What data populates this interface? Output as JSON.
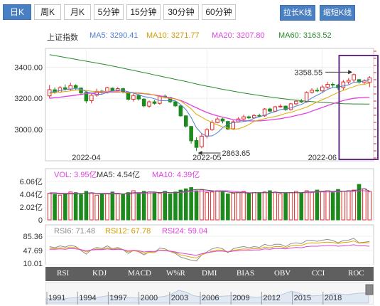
{
  "tabs": {
    "daily": "日K",
    "weekly": "周K",
    "monthly": "月K",
    "min5": "5分钟",
    "min15": "15分钟",
    "min30": "30分钟",
    "min60": "60分钟"
  },
  "buttons": {
    "stretch": "拉长K线",
    "shrink": "缩短K线"
  },
  "legend": {
    "name": "上证指数",
    "ma5": "MA5: 3290.41",
    "ma10": "MA10: 3271.77",
    "ma20": "MA20: 3207.80",
    "ma60": "MA60: 3163.52"
  },
  "volume_legend": {
    "vol": "VOL: 3.95亿",
    "ma5": "MA5: 4.54亿",
    "ma10": "MA10: 4.39亿"
  },
  "rsi_legend": {
    "rsi6": "RSI6: 71.48",
    "rsi12": "RSI12: 67.78",
    "rsi24": "RSI24: 59.04"
  },
  "indicator_tabs": [
    "RSI",
    "KDJ",
    "MACD",
    "W%R",
    "DMI",
    "BIAS",
    "OBV",
    "CCI",
    "ROC"
  ],
  "timeline_years": [
    "1991",
    "1994",
    "1997",
    "2000",
    "2003",
    "2006",
    "2009",
    "2012",
    "2015",
    "2018"
  ],
  "colors": {
    "up": "#e2292b",
    "down": "#1d8a1d",
    "ma5": "#4f7fd1",
    "ma10": "#e0a800",
    "ma20": "#e040e0",
    "ma60": "#2a8a2a",
    "rsi6": "#8e8e8e",
    "rsi12": "#e0a800",
    "rsi24": "#e040e0",
    "highlight_box": "#6b2d8a",
    "tab_active": "#4a7fc1"
  },
  "chart_data": [
    {
      "type": "candlestick",
      "ylim": [
        2800,
        3520
      ],
      "yticks": [
        3400,
        3200,
        3000
      ],
      "yticklabels": [
        "3400.00",
        "3200.00",
        "3000.00"
      ],
      "xticklabels": [
        "2022-04",
        "2022-05",
        "2022-06"
      ],
      "annotations": [
        {
          "text": "3358.55",
          "x": 58,
          "y": 3358.55
        },
        {
          "text": "2863.65",
          "x": 28,
          "y": 2863.65
        }
      ],
      "candles": [
        [
          3216,
          3256,
          3285,
          3200
        ],
        [
          3255,
          3240,
          3270,
          3230
        ],
        [
          3240,
          3268,
          3278,
          3235
        ],
        [
          3268,
          3260,
          3289,
          3250
        ],
        [
          3259,
          3282,
          3300,
          3248
        ],
        [
          3282,
          3268,
          3290,
          3255
        ],
        [
          3266,
          3235,
          3270,
          3220
        ],
        [
          3238,
          3184,
          3241,
          3170
        ],
        [
          3185,
          3220,
          3230,
          3168
        ],
        [
          3220,
          3245,
          3262,
          3210
        ],
        [
          3246,
          3238,
          3255,
          3228
        ],
        [
          3238,
          3268,
          3275,
          3231
        ],
        [
          3265,
          3248,
          3270,
          3238
        ],
        [
          3248,
          3262,
          3272,
          3240
        ],
        [
          3262,
          3242,
          3268,
          3232
        ],
        [
          3240,
          3194,
          3245,
          3186
        ],
        [
          3194,
          3218,
          3229,
          3180
        ],
        [
          3218,
          3196,
          3225,
          3186
        ],
        [
          3195,
          3152,
          3201,
          3143
        ],
        [
          3150,
          3178,
          3186,
          3140
        ],
        [
          3178,
          3168,
          3189,
          3160
        ],
        [
          3168,
          3212,
          3220,
          3160
        ],
        [
          3214,
          3208,
          3225,
          3200
        ],
        [
          3205,
          3178,
          3210,
          3170
        ],
        [
          3178,
          3152,
          3183,
          3145
        ],
        [
          3152,
          3088,
          3155,
          3083
        ],
        [
          3088,
          3022,
          3092,
          3012
        ],
        [
          3020,
          2928,
          3022,
          2910
        ],
        [
          2930,
          2886,
          2950,
          2863
        ],
        [
          2890,
          2958,
          2975,
          2880
        ],
        [
          2958,
          3000,
          3010,
          2944
        ],
        [
          3000,
          3045,
          3060,
          2992
        ],
        [
          3045,
          3068,
          3081,
          3040
        ],
        [
          3068,
          3055,
          3075,
          3040
        ],
        [
          3052,
          3004,
          3056,
          2998
        ],
        [
          3005,
          3050,
          3060,
          2998
        ],
        [
          3050,
          3068,
          3080,
          3045
        ],
        [
          3068,
          3082,
          3095,
          3060
        ],
        [
          3082,
          3075,
          3090,
          3066
        ],
        [
          3075,
          3090,
          3100,
          3068
        ],
        [
          3090,
          3088,
          3102,
          3080
        ],
        [
          3088,
          3132,
          3138,
          3082
        ],
        [
          3132,
          3118,
          3140,
          3110
        ],
        [
          3118,
          3146,
          3152,
          3112
        ],
        [
          3146,
          3150,
          3162,
          3140
        ],
        [
          3150,
          3128,
          3155,
          3120
        ],
        [
          3128,
          3165,
          3170,
          3122
        ],
        [
          3165,
          3182,
          3190,
          3158
        ],
        [
          3182,
          3178,
          3196,
          3170
        ],
        [
          3178,
          3238,
          3245,
          3172
        ],
        [
          3238,
          3252,
          3265,
          3230
        ],
        [
          3252,
          3248,
          3268,
          3240
        ],
        [
          3248,
          3273,
          3285,
          3238
        ],
        [
          3272,
          3290,
          3305,
          3262
        ],
        [
          3290,
          3285,
          3302,
          3270
        ],
        [
          3284,
          3268,
          3292,
          3254
        ],
        [
          3268,
          3305,
          3318,
          3255
        ],
        [
          3305,
          3315,
          3330,
          3290
        ],
        [
          3318,
          3352,
          3359,
          3300
        ],
        [
          3320,
          3304,
          3325,
          3294
        ],
        [
          3302,
          3312,
          3323,
          3288
        ],
        [
          3302,
          3332,
          3342,
          3272
        ]
      ],
      "ma5": [
        3238,
        3244,
        3250,
        3256,
        3260,
        3262,
        3259,
        3244,
        3233,
        3226,
        3226,
        3239,
        3248,
        3252,
        3251,
        3242,
        3233,
        3224,
        3211,
        3207,
        3198,
        3186,
        3185,
        3187,
        3184,
        3160,
        3128,
        3078,
        3012,
        2975,
        2958,
        2960,
        2980,
        3012,
        3035,
        3045,
        3048,
        3052,
        3056,
        3073,
        3081,
        3093,
        3105,
        3115,
        3128,
        3134,
        3138,
        3151,
        3161,
        3178,
        3203,
        3220,
        3237,
        3258,
        3270,
        3274,
        3279,
        3286,
        3303,
        3305,
        3312,
        3322
      ],
      "ma10": [
        3232,
        3236,
        3240,
        3244,
        3248,
        3252,
        3254,
        3250,
        3246,
        3243,
        3243,
        3246,
        3246,
        3243,
        3239,
        3234,
        3236,
        3236,
        3232,
        3229,
        3220,
        3210,
        3205,
        3199,
        3196,
        3183,
        3158,
        3133,
        3098,
        3080,
        3060,
        3045,
        3030,
        3018,
        3010,
        3002,
        3005,
        3016,
        3032,
        3052,
        3062,
        3070,
        3078,
        3084,
        3092,
        3104,
        3110,
        3122,
        3132,
        3144,
        3160,
        3177,
        3192,
        3206,
        3222,
        3238,
        3251,
        3264,
        3275,
        3286,
        3290,
        3298
      ],
      "ma20": [
        3200,
        3204,
        3208,
        3212,
        3216,
        3220,
        3226,
        3230,
        3234,
        3236,
        3238,
        3240,
        3240,
        3240,
        3240,
        3238,
        3236,
        3233,
        3230,
        3226,
        3222,
        3216,
        3210,
        3204,
        3196,
        3186,
        3172,
        3156,
        3140,
        3124,
        3110,
        3098,
        3088,
        3080,
        3072,
        3064,
        3060,
        3057,
        3056,
        3055,
        3056,
        3058,
        3062,
        3066,
        3070,
        3076,
        3082,
        3090,
        3098,
        3106,
        3118,
        3130,
        3142,
        3154,
        3165,
        3176,
        3186,
        3194,
        3200,
        3204,
        3206,
        3208
      ],
      "ma60": [
        3480,
        3474,
        3468,
        3462,
        3456,
        3450,
        3444,
        3438,
        3432,
        3426,
        3420,
        3414,
        3407,
        3400,
        3393,
        3386,
        3379,
        3372,
        3365,
        3358,
        3350,
        3343,
        3336,
        3329,
        3322,
        3315,
        3308,
        3300,
        3292,
        3285,
        3278,
        3272,
        3265,
        3258,
        3252,
        3246,
        3240,
        3234,
        3229,
        3224,
        3219,
        3214,
        3209,
        3205,
        3200,
        3196,
        3192,
        3189,
        3185,
        3182,
        3179,
        3176,
        3174,
        3172,
        3170,
        3168,
        3166,
        3165,
        3164,
        3164,
        3163,
        3163
      ]
    },
    {
      "type": "bar",
      "yticklabels": [
        "6.06亿",
        "4.04亿",
        "2.02亿",
        "0"
      ],
      "ylim": [
        0,
        6.06
      ],
      "values": [
        4.2,
        4.0,
        3.9,
        4.1,
        4.4,
        4.3,
        4.0,
        4.5,
        4.2,
        3.9,
        4.0,
        4.1,
        4.4,
        4.2,
        4.0,
        4.3,
        4.6,
        4.2,
        4.5,
        4.4,
        4.3,
        4.2,
        4.5,
        4.1,
        4.4,
        4.7,
        4.9,
        5.1,
        4.6,
        4.8,
        4.3,
        4.4,
        4.6,
        4.4,
        4.1,
        4.2,
        4.3,
        4.5,
        4.1,
        4.3,
        4.2,
        4.4,
        4.6,
        4.3,
        4.1,
        4.2,
        4.3,
        4.5,
        4.2,
        4.6,
        4.4,
        4.7,
        4.5,
        4.6,
        4.3,
        4.8,
        4.5,
        4.6,
        4.7,
        5.6,
        4.9,
        4.5
      ],
      "ma5": [
        4.2,
        4.2,
        4.1,
        4.1,
        4.1,
        4.1,
        4.2,
        4.2,
        4.3,
        4.2,
        4.1,
        4.1,
        4.1,
        4.1,
        4.1,
        4.2,
        4.3,
        4.3,
        4.3,
        4.4,
        4.4,
        4.3,
        4.4,
        4.3,
        4.3,
        4.4,
        4.5,
        4.7,
        4.8,
        4.8,
        4.7,
        4.6,
        4.5,
        4.5,
        4.4,
        4.3,
        4.3,
        4.3,
        4.2,
        4.3,
        4.3,
        4.3,
        4.3,
        4.4,
        4.3,
        4.3,
        4.3,
        4.3,
        4.3,
        4.4,
        4.4,
        4.5,
        4.5,
        4.6,
        4.5,
        4.6,
        4.5,
        4.6,
        4.6,
        4.8,
        4.9,
        4.54
      ],
      "ma10": [
        4.3,
        4.3,
        4.2,
        4.2,
        4.2,
        4.2,
        4.2,
        4.2,
        4.2,
        4.2,
        4.2,
        4.2,
        4.2,
        4.2,
        4.1,
        4.1,
        4.2,
        4.2,
        4.2,
        4.2,
        4.3,
        4.3,
        4.3,
        4.3,
        4.3,
        4.3,
        4.4,
        4.5,
        4.5,
        4.6,
        4.5,
        4.5,
        4.6,
        4.6,
        4.6,
        4.5,
        4.4,
        4.4,
        4.3,
        4.3,
        4.3,
        4.3,
        4.3,
        4.3,
        4.3,
        4.3,
        4.3,
        4.3,
        4.3,
        4.3,
        4.3,
        4.4,
        4.4,
        4.4,
        4.4,
        4.4,
        4.5,
        4.5,
        4.5,
        4.6,
        4.6,
        4.39
      ]
    },
    {
      "type": "line",
      "yticklabels": [
        "85.36",
        "47.69",
        "10.01"
      ],
      "ylim": [
        10.01,
        85.36
      ],
      "series": [
        {
          "name": "RSI6",
          "values": [
            58,
            55,
            60,
            57,
            62,
            58,
            48,
            38,
            50,
            56,
            53,
            60,
            52,
            56,
            50,
            40,
            48,
            44,
            36,
            44,
            42,
            54,
            52,
            45,
            40,
            30,
            26,
            22,
            20,
            36,
            44,
            52,
            56,
            52,
            42,
            52,
            56,
            58,
            55,
            58,
            56,
            64,
            60,
            64,
            64,
            58,
            66,
            68,
            66,
            74,
            75,
            72,
            75,
            77,
            74,
            68,
            74,
            75,
            80,
            68,
            70,
            71.48
          ]
        },
        {
          "name": "RSI12",
          "values": [
            54,
            53,
            55,
            54,
            57,
            55,
            50,
            44,
            49,
            52,
            51,
            55,
            51,
            53,
            50,
            44,
            47,
            45,
            40,
            43,
            42,
            49,
            48,
            45,
            42,
            36,
            33,
            30,
            28,
            36,
            41,
            46,
            49,
            48,
            44,
            48,
            50,
            52,
            51,
            53,
            52,
            57,
            55,
            58,
            58,
            55,
            60,
            62,
            61,
            66,
            68,
            67,
            69,
            70,
            69,
            66,
            69,
            70,
            73,
            67,
            68,
            67.78
          ]
        },
        {
          "name": "RSI24",
          "values": [
            51,
            51,
            52,
            51,
            53,
            52,
            50,
            47,
            49,
            50,
            50,
            52,
            50,
            51,
            50,
            47,
            48,
            47,
            44,
            45,
            45,
            48,
            47,
            46,
            44,
            41,
            39,
            37,
            35,
            39,
            42,
            44,
            46,
            46,
            44,
            46,
            47,
            48,
            48,
            49,
            49,
            52,
            51,
            53,
            53,
            52,
            54,
            56,
            55,
            58,
            59,
            59,
            60,
            61,
            61,
            59,
            60,
            61,
            63,
            60,
            60,
            59.04
          ]
        }
      ]
    }
  ]
}
